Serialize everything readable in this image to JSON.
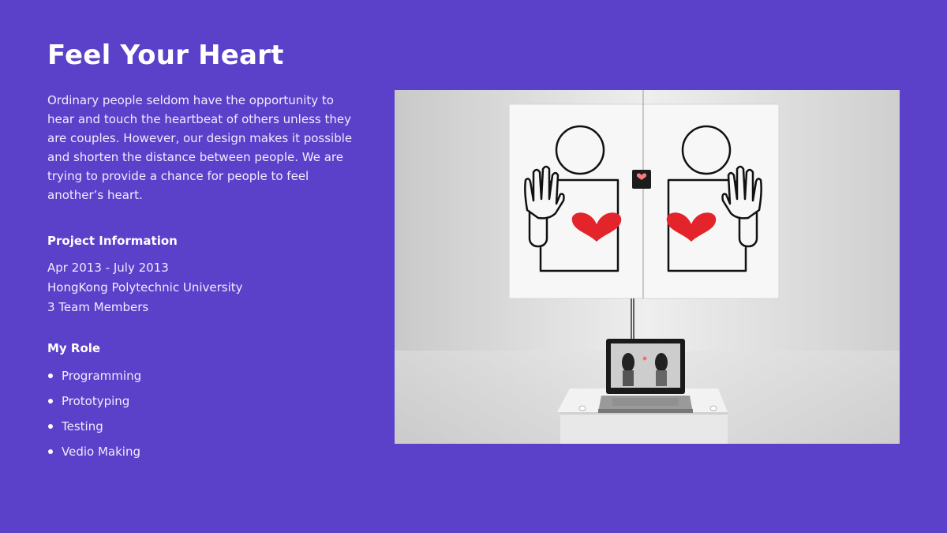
{
  "page": {
    "title": "Feel Your Heart",
    "description": "Ordinary people seldom have the opportunity to hear and touch the heartbeat of others unless they are couples. However, our design makes it possible and shorten the distance between people. We are trying to provide a chance for people to feel another’s heart."
  },
  "project_info": {
    "heading": "Project Information",
    "dates": "Apr 2013 - July 2013",
    "institution": "HongKong Polytechnic University",
    "team": "3 Team Members"
  },
  "role": {
    "heading": "My Role",
    "items": [
      "Programming",
      "Prototyping",
      "Testing",
      "Vedio Making"
    ]
  },
  "colors": {
    "background": "#5b40c9",
    "heart": "#e3242b",
    "text": "#ffffff"
  },
  "photo": {
    "icon": "installation-photo"
  }
}
